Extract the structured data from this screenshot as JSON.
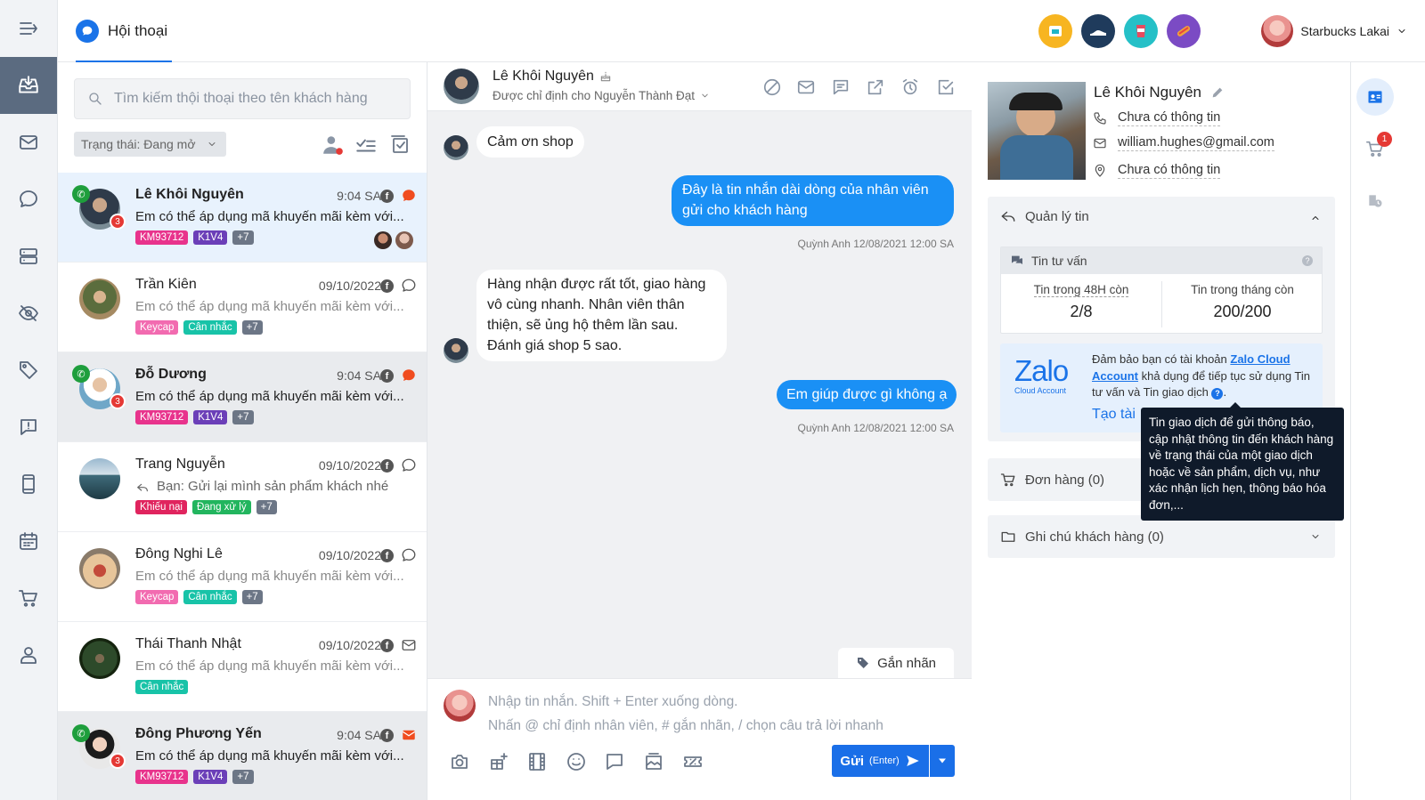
{
  "topbar": {
    "title": "Hội thoại",
    "user_name": "Starbucks Lakai",
    "apps": [
      "app-1",
      "app-2",
      "app-3",
      "app-4"
    ]
  },
  "nav": [
    "menu",
    "inbox",
    "mail",
    "chat",
    "server",
    "eye-off",
    "tag",
    "feedback",
    "device",
    "calendar",
    "cart",
    "user"
  ],
  "list": {
    "search_placeholder": "Tìm kiếm thội thoại theo tên khách hàng",
    "filter_label": "Trạng thái: Đang mở",
    "rows": [
      {
        "name": "Lê Khôi Nguyên",
        "time": "9:04 SA",
        "msg": "Em có thể áp dụng mã khuyến mãi kèm với...",
        "tags": [
          "KM93712",
          "K1V4",
          "+7"
        ],
        "badge": "3",
        "unread": true
      },
      {
        "name": "Trần Kiên",
        "time": "09/10/2022",
        "msg": "Em có thể áp dụng mã khuyến mãi kèm với...",
        "tags": [
          "Keycap",
          "Cân nhắc",
          "+7"
        ],
        "badge": "",
        "unread": false
      },
      {
        "name": "Đỗ Dương",
        "time": "9:04 SA",
        "msg": "Em có thể áp dụng mã khuyến mãi kèm với...",
        "tags": [
          "KM93712",
          "K1V4",
          "+7"
        ],
        "badge": "3",
        "unread": true
      },
      {
        "name": "Trang Nguyễn",
        "time": "09/10/2022",
        "msg": "Bạn: Gửi lại mình sản phẩm khách nhé",
        "tags": [
          "Khiếu nại",
          "Đang xử lý",
          "+7"
        ],
        "badge": "",
        "unread": false
      },
      {
        "name": "Đông Nghi Lê",
        "time": "09/10/2022",
        "msg": "Em có thể áp dụng mã khuyến mãi kèm với...",
        "tags": [
          "Keycap",
          "Cân nhắc",
          "+7"
        ],
        "badge": "",
        "unread": false
      },
      {
        "name": "Thái Thanh Nhật",
        "time": "09/10/2022",
        "msg": "Em có thể áp dụng mã khuyến mãi kèm với...",
        "tags": [
          "Cân nhắc"
        ],
        "badge": "",
        "unread": false
      },
      {
        "name": "Đông Phương Yến",
        "time": "9:04 SA",
        "msg": "Em có thể áp dụng mã khuyến mãi kèm với...",
        "tags": [
          "KM93712",
          "K1V4",
          "+7"
        ],
        "badge": "3",
        "unread": true
      }
    ]
  },
  "chat": {
    "customer_name": "Lê Khôi Nguyên",
    "assigned": "Được chỉ định cho Nguyễn Thành Đạt",
    "messages": [
      {
        "dir": "in",
        "text": "Cảm ơn shop"
      },
      {
        "dir": "out",
        "text": "Đây là tin nhắn dài dòng của nhân viên gửi cho khách hàng",
        "meta": "Quỳnh Anh 12/08/2021 12:00 SA"
      },
      {
        "dir": "in",
        "text": "Hàng nhận được rất tốt, giao hàng vô cùng nhanh. Nhân viên thân thiện, sẽ ủng hộ thêm lần sau. Đánh giá shop 5 sao."
      },
      {
        "dir": "out",
        "text": "Em giúp được gì không ạ",
        "meta": "Quỳnh Anh 12/08/2021 12:00 SA"
      }
    ],
    "tag_button": "Gắn nhãn",
    "placeholder_1": "Nhập tin nhắn. Shift + Enter xuống dòng.",
    "placeholder_2": "Nhấn @ chỉ định nhân viên, # gắn nhãn, / chọn câu trả lời nhanh",
    "send_label": "Gửi",
    "send_hint": "(Enter)"
  },
  "customer": {
    "name": "Lê Khôi Nguyên",
    "phone": "Chưa có thông tin",
    "email": "william.hughes@gmail.com",
    "address": "Chưa có thông tin",
    "quota_section": "Quản lý tin",
    "quota_box_title": "Tin tư vấn",
    "quota_48h_label": "Tin trong 48H còn",
    "quota_48h_value": "2/8",
    "quota_month_label": "Tin trong tháng còn",
    "quota_month_value": "200/200",
    "zalo_logo": "Zalo",
    "zalo_sub": "Cloud Account",
    "zalo_notice_1": "Đảm bảo bạn có tài khoản ",
    "zalo_notice_link": "Zalo Cloud Account",
    "zalo_notice_2": " khả dụng để tiếp tục sử dụng Tin tư vấn và Tin giao dịch",
    "zalo_create": "Tạo tài",
    "tooltip": "Tin giao dịch để gửi thông báo, cập nhật thông tin đến khách hàng về trạng thái của một giao dịch hoặc về sản phẩm, dịch vụ, như xác nhận lịch hẹn, thông báo hóa đơn,...",
    "orders": "Đơn hàng (0)",
    "notes": "Ghi chú khách hàng (0)"
  },
  "farright": {
    "cart_badge": "1"
  },
  "colors": {
    "primary": "#1a90f5",
    "tag_pink": "#e8338c",
    "tag_purple": "#6b3fb8",
    "tag_gray": "#6c7686",
    "tag_teal": "#18c3a8",
    "tag_red": "#e0245e",
    "tag_green": "#22b55e",
    "tag_light_pink": "#f26bb0",
    "zalo": "#1a73e8"
  }
}
